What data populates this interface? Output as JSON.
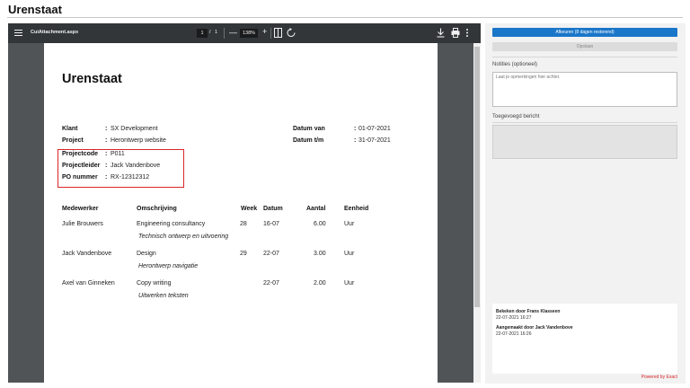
{
  "page": {
    "title": "Urenstaat"
  },
  "viewer": {
    "filename": "CuiAttachment.aspx",
    "page_current": "1",
    "page_sep": "/",
    "page_total": "1",
    "zoom": "138%",
    "zoom_minus": "—",
    "zoom_plus": "+"
  },
  "document": {
    "title": "Urenstaat",
    "fields_left": [
      {
        "label": "Klant",
        "sep": ":",
        "value": "SX Development"
      },
      {
        "label": "Project",
        "sep": ":",
        "value": "Herontwerp website"
      },
      {
        "label": "Projectcode",
        "sep": ":",
        "value": "P011"
      },
      {
        "label": "Projectleider",
        "sep": ":",
        "value": "Jack Vandenbove"
      },
      {
        "label": "PO nummer",
        "sep": ":",
        "value": "RX-12312312"
      }
    ],
    "fields_right": [
      {
        "label": "Datum van",
        "sep": ":",
        "value": "01-07-2021"
      },
      {
        "label": "Datum t/m",
        "sep": ":",
        "value": "31-07-2021"
      }
    ],
    "table": {
      "headers": {
        "employee": "Medewerker",
        "description": "Omschrijving",
        "week": "Week",
        "date": "Datum",
        "amount": "Aantal",
        "unit": "Eenheid"
      },
      "rows": [
        {
          "employee": "Julie Brouwers",
          "description": "Engineering consultancy",
          "week": "28",
          "date": "16-07",
          "amount": "6.00",
          "unit": "Uur",
          "note": "Technisch ontwerp en uitvoering"
        },
        {
          "employee": "Jack Vandenbove",
          "description": "Design",
          "week": "29",
          "date": "22-07",
          "amount": "3.00",
          "unit": "Uur",
          "note": "Herontwerp navigatie"
        },
        {
          "employee": "Axel van Ginneken",
          "description": "Copy writing",
          "week": "",
          "date": "22-07",
          "amount": "2.00",
          "unit": "Uur",
          "note": "Uitwerken teksten"
        }
      ]
    }
  },
  "panel": {
    "accept_label": "Afkeuren (8 dagen resterend)",
    "save_label": "Opslaan",
    "notes_label": "Notities (optioneel)",
    "notes_placeholder": "Laat je opmerkingen hier achter.",
    "message_label": "Toegevoegd bericht",
    "history": [
      {
        "title": "Bekeken door Frans Klasseen",
        "date": "22-07-2021 16:27"
      },
      {
        "title": "Aangemaakt door Jack Vandenbove",
        "date": "22-07-2021 16:26"
      }
    ],
    "powered_by": "Powered by Exact"
  },
  "colors": {
    "primary": "#1a76c9",
    "highlight": "#d9262b",
    "viewer_toolbar": "#323639",
    "viewer_bg": "#505457"
  }
}
